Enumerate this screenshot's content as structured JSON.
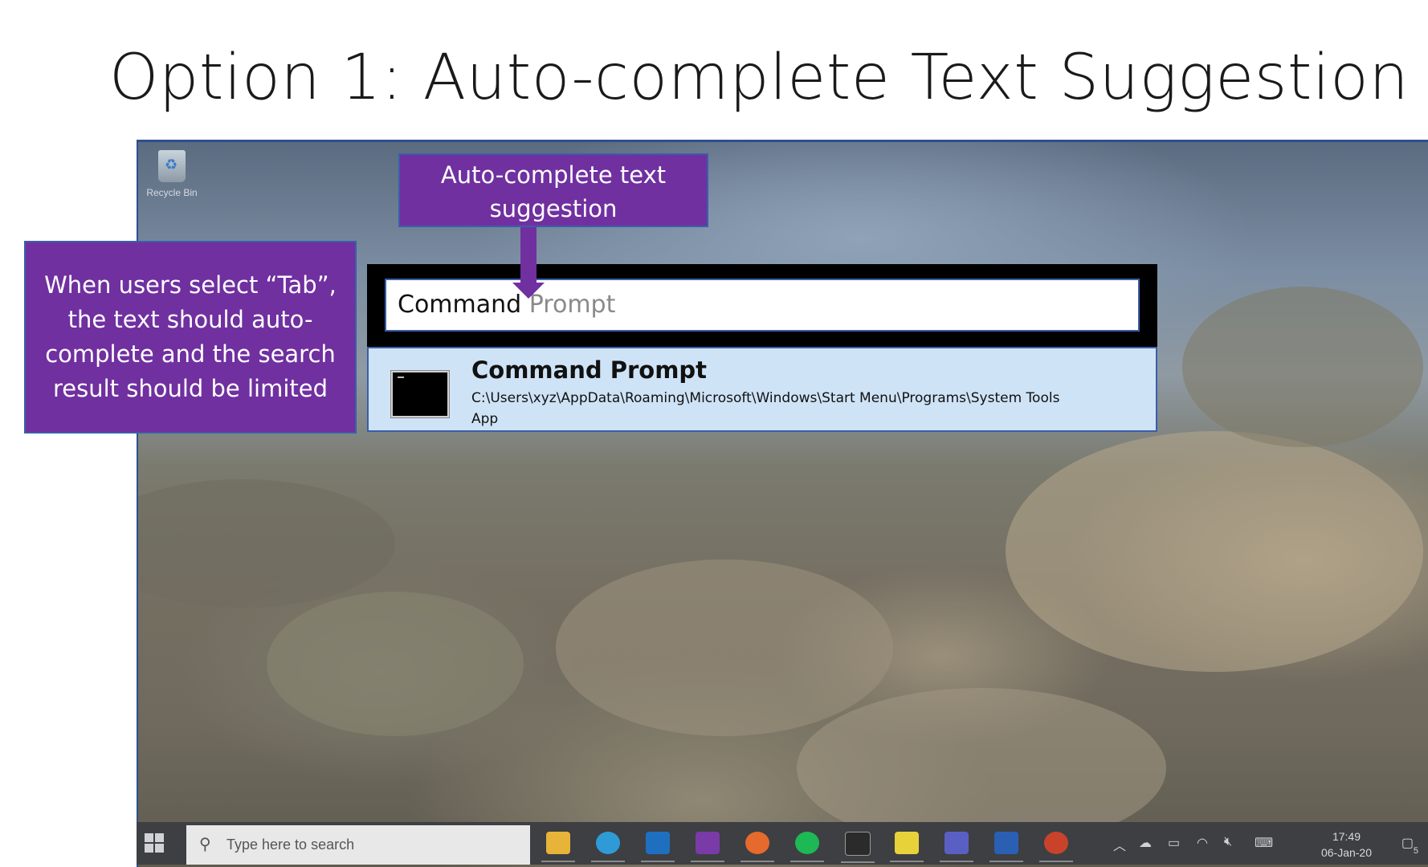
{
  "slide": {
    "title": "Option 1: Auto-complete Text Suggestion"
  },
  "desktop": {
    "recycle_bin_label": "Recycle Bin"
  },
  "search": {
    "typed": "Command",
    "suggestion": " Prompt"
  },
  "result": {
    "title": "Command Prompt",
    "path": "C:\\Users\\xyz\\AppData\\Roaming\\Microsoft\\Windows\\Start Menu\\Programs\\System Tools",
    "type": "App"
  },
  "callouts": {
    "top_line1": "Auto-complete text",
    "top_line2": "suggestion",
    "left_line1": "When users select “Tab”,",
    "left_line2": "the text should auto-",
    "left_line3": "complete and the search",
    "left_line4": "result should be limited"
  },
  "taskbar": {
    "search_placeholder": "Type here to search",
    "apps": [
      "file-explorer",
      "edge-beta",
      "outlook",
      "onenote",
      "firefox",
      "spotify",
      "terminal",
      "sticky-notes",
      "teams",
      "word",
      "powerpoint"
    ],
    "time": "17:49",
    "date": "06-Jan-20",
    "notification_count": "5"
  },
  "colors": {
    "callout": "#7030a0",
    "callout_border": "#3b5ea8",
    "result_bg": "#cfe3f7",
    "taskbar": "#3d3f43"
  }
}
